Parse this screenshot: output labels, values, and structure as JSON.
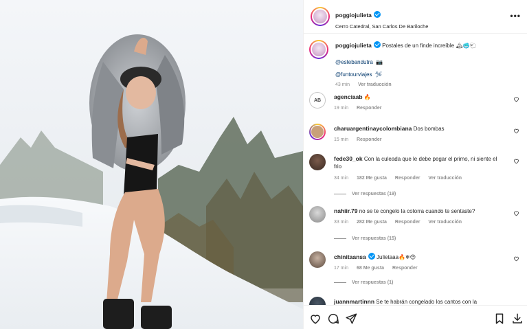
{
  "post": {
    "username": "poggiojulieta",
    "location": "Cerro Catedral, San Carlos De Bariloche",
    "caption_text": "Postales de un finde increíble",
    "caption_emoji": "🏔🥶🐑",
    "mention_1": "@estebandutra",
    "mention_1_emoji": "📷",
    "mention_2": "@funtourviajes",
    "mention_2_emoji": "🛩",
    "time": "43 min",
    "translate": "Ver traducción"
  },
  "comments": [
    {
      "user": "agenciaab",
      "text": "🔥",
      "time": "19 min",
      "reply": "Responder"
    },
    {
      "user": "charuargentinaycolombiana",
      "text": "Dos bombas",
      "time": "15 min",
      "reply": "Responder"
    },
    {
      "user": "fede30_ok",
      "text": "Con la culeada que le debe pegar el primo, ni siente el frio",
      "time": "34 min",
      "likes": "182 Me gusta",
      "reply": "Responder",
      "translate": "Ver traducción",
      "view_replies": "Ver respuestas (19)"
    },
    {
      "user": "nahiir.79",
      "text": "no se te congelo la cotorra cuando te sentaste?",
      "time": "33 min",
      "likes": "282 Me gusta",
      "reply": "Responder",
      "translate": "Ver traducción",
      "view_replies": "Ver respuestas (15)"
    },
    {
      "user": "chinitaansa",
      "text": "Julietaaa🔥❄😍",
      "time": "17 min",
      "likes": "68 Me gusta",
      "reply": "Responder",
      "view_replies": "Ver respuestas (1)"
    },
    {
      "user": "juannmartinnn",
      "text": "Se te habrán congelado los cantos con la"
    }
  ],
  "icons": {
    "more": "more-options-icon",
    "heart": "heart-icon",
    "comment": "comment-icon",
    "share": "send-icon",
    "save": "bookmark-icon",
    "download": "download-icon"
  },
  "colors": {
    "link": "#00376b",
    "verified": "#0095f6",
    "muted": "#8e8e8e"
  }
}
